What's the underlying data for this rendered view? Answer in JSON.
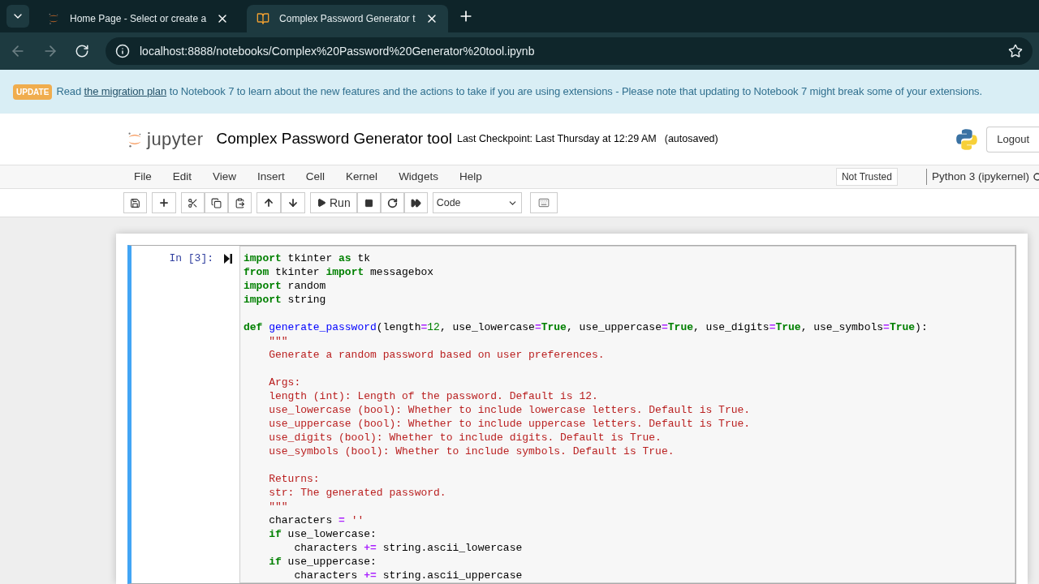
{
  "browser": {
    "tabs": [
      {
        "title": "Home Page - Select or create a",
        "kind": "jupyter",
        "selected": false
      },
      {
        "title": "Complex Password Generator t",
        "kind": "notebook",
        "selected": true
      }
    ],
    "url": "localhost:8888/notebooks/Complex%20Password%20Generator%20tool.ipynb"
  },
  "banner": {
    "badge": "UPDATE",
    "before": "Read ",
    "link": "the migration plan",
    "after": " to Notebook 7 to learn about the new features and the actions to take if you are using extensions - Please note that updating to Notebook 7 might break some of your extensions."
  },
  "header": {
    "logo_text": "jupyter",
    "title": "Complex Password Generator tool",
    "checkpoint": "Last Checkpoint: Last Thursday at 12:29 AM",
    "autosave": "(autosaved)",
    "logout": "Logout"
  },
  "menu": {
    "items": [
      "File",
      "Edit",
      "View",
      "Insert",
      "Cell",
      "Kernel",
      "Widgets",
      "Help"
    ],
    "trust": "Not Trusted",
    "kernel": "Python 3 (ipykernel)"
  },
  "toolbar": {
    "run": "Run",
    "cell_type": "Code"
  },
  "cell": {
    "prompt": "In [3]:",
    "selected": true,
    "lines": [
      {
        "tokens": [
          {
            "kind": "kw",
            "text": "import"
          },
          {
            "kind": "p",
            "text": " tkinter "
          },
          {
            "kind": "kw",
            "text": "as"
          },
          {
            "kind": "p",
            "text": " tk"
          }
        ]
      },
      {
        "tokens": [
          {
            "kind": "kw",
            "text": "from"
          },
          {
            "kind": "p",
            "text": " tkinter "
          },
          {
            "kind": "kw",
            "text": "import"
          },
          {
            "kind": "p",
            "text": " messagebox"
          }
        ]
      },
      {
        "tokens": [
          {
            "kind": "kw",
            "text": "import"
          },
          {
            "kind": "p",
            "text": " random"
          }
        ]
      },
      {
        "tokens": [
          {
            "kind": "kw",
            "text": "import"
          },
          {
            "kind": "p",
            "text": " string"
          }
        ]
      },
      {
        "kind": "blank"
      },
      {
        "tokens": [
          {
            "kind": "kw",
            "text": "def"
          },
          {
            "kind": "fn",
            "text": " generate_password"
          },
          {
            "kind": "p",
            "text": "(length"
          },
          {
            "kind": "op",
            "text": "="
          },
          {
            "kind": "num",
            "text": "12"
          },
          {
            "kind": "p",
            "text": ", use_lowercase"
          },
          {
            "kind": "op",
            "text": "="
          },
          {
            "kind": "kw",
            "text": "True"
          },
          {
            "kind": "p",
            "text": ", use_uppercase"
          },
          {
            "kind": "op",
            "text": "="
          },
          {
            "kind": "kw",
            "text": "True"
          },
          {
            "kind": "p",
            "text": ", use_digits"
          },
          {
            "kind": "op",
            "text": "="
          },
          {
            "kind": "kw",
            "text": "True"
          },
          {
            "kind": "p",
            "text": ", use_symbols"
          },
          {
            "kind": "op",
            "text": "="
          },
          {
            "kind": "kw",
            "text": "True"
          },
          {
            "kind": "p",
            "text": "):"
          }
        ]
      },
      {
        "tokens": [
          {
            "kind": "str",
            "text": "    \"\"\""
          }
        ]
      },
      {
        "tokens": [
          {
            "kind": "str",
            "text": "    Generate a random password based on user preferences."
          }
        ]
      },
      {
        "kind": "blank"
      },
      {
        "tokens": [
          {
            "kind": "str",
            "text": "    Args:"
          }
        ]
      },
      {
        "tokens": [
          {
            "kind": "str",
            "text": "    length (int): Length of the password. Default is 12."
          }
        ]
      },
      {
        "tokens": [
          {
            "kind": "str",
            "text": "    use_lowercase (bool): Whether to include lowercase letters. Default is True."
          }
        ]
      },
      {
        "tokens": [
          {
            "kind": "str",
            "text": "    use_uppercase (bool): Whether to include uppercase letters. Default is True."
          }
        ]
      },
      {
        "tokens": [
          {
            "kind": "str",
            "text": "    use_digits (bool): Whether to include digits. Default is True."
          }
        ]
      },
      {
        "tokens": [
          {
            "kind": "str",
            "text": "    use_symbols (bool): Whether to include symbols. Default is True."
          }
        ]
      },
      {
        "kind": "blank"
      },
      {
        "tokens": [
          {
            "kind": "str",
            "text": "    Returns:"
          }
        ]
      },
      {
        "tokens": [
          {
            "kind": "str",
            "text": "    str: The generated password."
          }
        ]
      },
      {
        "tokens": [
          {
            "kind": "str",
            "text": "    \"\"\""
          }
        ]
      },
      {
        "tokens": [
          {
            "kind": "p",
            "text": "    characters "
          },
          {
            "kind": "op",
            "text": "="
          },
          {
            "kind": "str",
            "text": " ''"
          }
        ]
      },
      {
        "tokens": [
          {
            "kind": "kw",
            "text": "    if"
          },
          {
            "kind": "p",
            "text": " use_lowercase:"
          }
        ]
      },
      {
        "tokens": [
          {
            "kind": "p",
            "text": "        characters "
          },
          {
            "kind": "op",
            "text": "+="
          },
          {
            "kind": "p",
            "text": " string.ascii_lowercase"
          }
        ]
      },
      {
        "tokens": [
          {
            "kind": "kw",
            "text": "    if"
          },
          {
            "kind": "p",
            "text": " use_uppercase:"
          }
        ]
      },
      {
        "tokens": [
          {
            "kind": "p",
            "text": "        characters "
          },
          {
            "kind": "op",
            "text": "+="
          },
          {
            "kind": "p",
            "text": " string.ascii_uppercase"
          }
        ]
      }
    ]
  }
}
